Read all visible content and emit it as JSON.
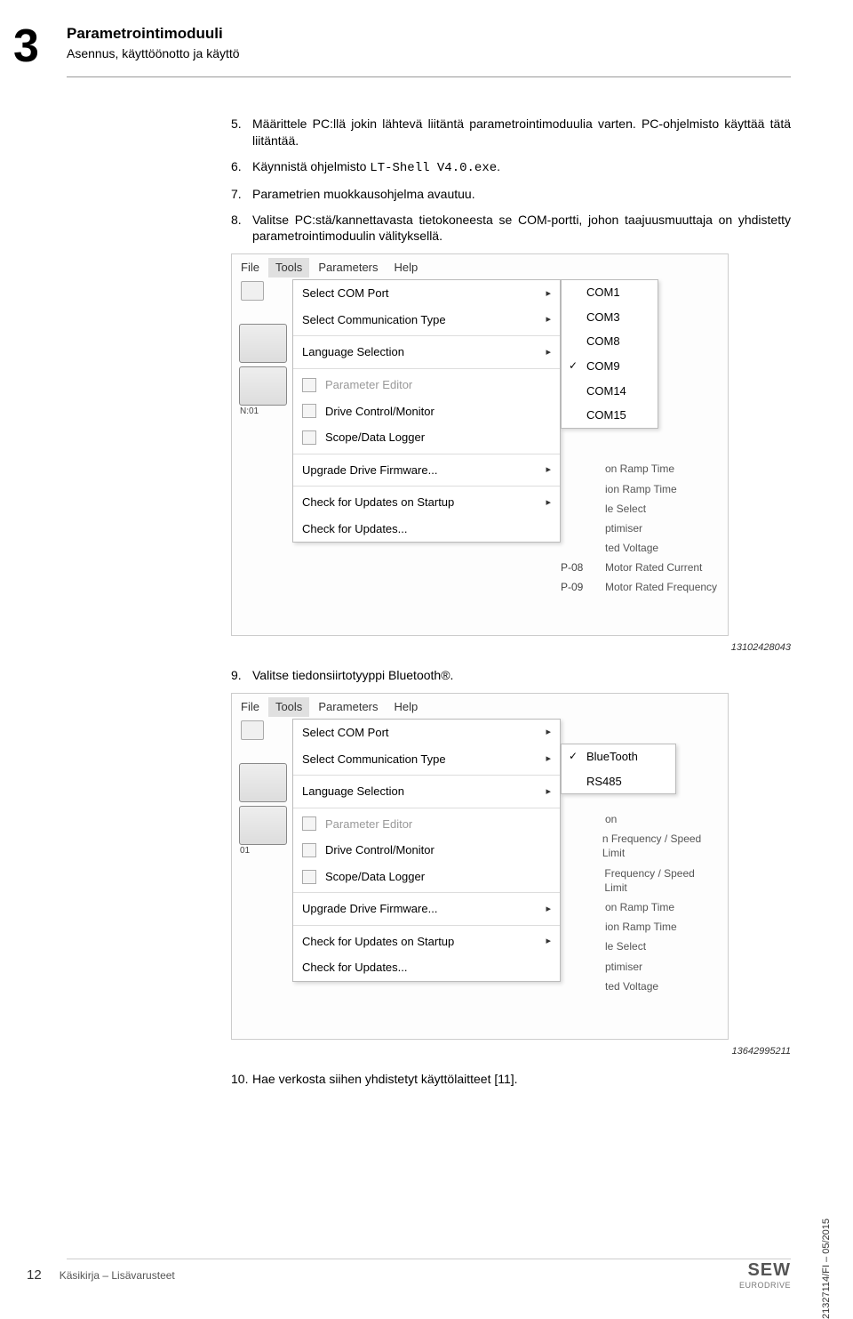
{
  "chapter_number": "3",
  "header": {
    "title": "Parametrointimoduuli",
    "subtitle": "Asennus, käyttöönotto ja käyttö"
  },
  "items": [
    {
      "num": "5.",
      "text": "Määrittele PC:llä jokin lähtevä liitäntä parametrointimoduulia varten. PC-ohjelmisto käyttää tätä liitäntää."
    },
    {
      "num": "6.",
      "text": "Käynnistä ohjelmisto ",
      "mono": "LT-Shell V4.0.exe",
      "tail": "."
    },
    {
      "num": "7.",
      "text": "Parametrien muokkausohjelma avautuu."
    },
    {
      "num": "8.",
      "text": "Valitse PC:stä/kannettavasta tietokoneesta se COM-portti, johon taajuusmuuttaja on yhdistetty parametrointimoduulin välityksellä."
    }
  ],
  "screenshot1": {
    "menubar": [
      "File",
      "Tools",
      "Parameters",
      "Help"
    ],
    "dropdown": [
      {
        "label": "Select COM Port",
        "arrow": true
      },
      {
        "label": "Select Communication Type",
        "arrow": true
      },
      {
        "sep": true
      },
      {
        "label": "Language Selection",
        "arrow": true
      },
      {
        "sep": true
      },
      {
        "label": "Parameter Editor",
        "disabled": true,
        "icon": true
      },
      {
        "label": "Drive Control/Monitor",
        "icon": true
      },
      {
        "label": "Scope/Data Logger",
        "icon": true
      },
      {
        "sep": true
      },
      {
        "label": "Upgrade Drive Firmware...",
        "arrow": true
      },
      {
        "sep": true
      },
      {
        "label": "Check for Updates on Startup",
        "arrow": true
      },
      {
        "label": "Check for Updates..."
      }
    ],
    "submenu": [
      "COM1",
      "COM3",
      "COM8",
      "COM9",
      "COM14",
      "COM15"
    ],
    "submenu_checked": "COM9",
    "bg_params": [
      {
        "p": "",
        "label": "on Ramp Time"
      },
      {
        "p": "",
        "label": "ion Ramp Time"
      },
      {
        "p": "",
        "label": "le Select"
      },
      {
        "p": "",
        "label": "ptimiser"
      },
      {
        "p": "",
        "label": "ted Voltage"
      },
      {
        "p": "P-08",
        "label": "Motor Rated Current"
      },
      {
        "p": "P-09",
        "label": "Motor Rated Frequency"
      }
    ],
    "dev_label": "N:01",
    "img_number": "13102428043"
  },
  "step9": {
    "num": "9.",
    "text": "Valitse tiedonsiirtotyyppi Bluetooth®."
  },
  "screenshot2": {
    "menubar": [
      "File",
      "Tools",
      "Parameters",
      "Help"
    ],
    "dropdown": [
      {
        "label": "Select COM Port",
        "arrow": true
      },
      {
        "label": "Select Communication Type",
        "arrow": true
      },
      {
        "sep": true
      },
      {
        "label": "Language Selection",
        "arrow": true
      },
      {
        "sep": true
      },
      {
        "label": "Parameter Editor",
        "disabled": true,
        "icon": true
      },
      {
        "label": "Drive Control/Monitor",
        "icon": true
      },
      {
        "label": "Scope/Data Logger",
        "icon": true
      },
      {
        "sep": true
      },
      {
        "label": "Upgrade Drive Firmware...",
        "arrow": true
      },
      {
        "sep": true
      },
      {
        "label": "Check for Updates on Startup",
        "arrow": true
      },
      {
        "label": "Check for Updates..."
      }
    ],
    "submenu": [
      "BlueTooth",
      "RS485"
    ],
    "submenu_checked": "BlueTooth",
    "bg_params": [
      {
        "p": "",
        "label": "on"
      },
      {
        "p": "",
        "label": "n Frequency / Speed Limit"
      },
      {
        "p": "",
        "label": "Frequency / Speed Limit"
      },
      {
        "p": "",
        "label": "on Ramp Time"
      },
      {
        "p": "",
        "label": "ion Ramp Time"
      },
      {
        "p": "",
        "label": "le Select"
      },
      {
        "p": "",
        "label": "ptimiser"
      },
      {
        "p": "",
        "label": "ted Voltage"
      }
    ],
    "dev_label": "01",
    "img_number": "13642995211"
  },
  "step10": {
    "num": "10.",
    "text": "Hae verkosta siihen yhdistetyt käyttölaitteet [11]."
  },
  "sidetext": "21327114/FI – 05/2015",
  "footer": {
    "page": "12",
    "text": "Käsikirja – Lisävarusteet",
    "logo1": "SEW",
    "logo2": "EURODRIVE"
  }
}
